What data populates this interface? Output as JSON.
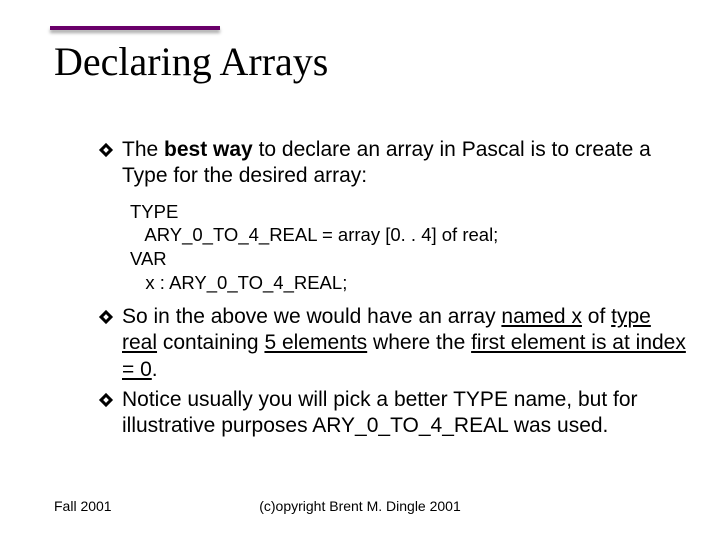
{
  "title": "Declaring Arrays",
  "bullets": {
    "b1_pre": "The ",
    "b1_bold": "best way",
    "b1_post": " to declare an array in Pascal is to create a Type for the desired array:",
    "b2_pre": "So in the above we would have an array ",
    "b2_u1": "named x",
    "b2_mid1": " of ",
    "b2_u2": "type real",
    "b2_mid2": " containing ",
    "b2_u3": "5 elements",
    "b2_mid3": " where the ",
    "b2_u4": "first element is at index = 0",
    "b2_post": ".",
    "b3": "Notice usually you will pick a better TYPE name, but for illustrative purposes ARY_0_TO_4_REAL was used."
  },
  "code": {
    "l1": "TYPE",
    "l2": "   ARY_0_TO_4_REAL = array [0. . 4] of real;",
    "l3": "VAR",
    "l4": "   x : ARY_0_TO_4_REAL;"
  },
  "footer": {
    "left": "Fall 2001",
    "center": "(c)opyright Brent M. Dingle 2001"
  }
}
